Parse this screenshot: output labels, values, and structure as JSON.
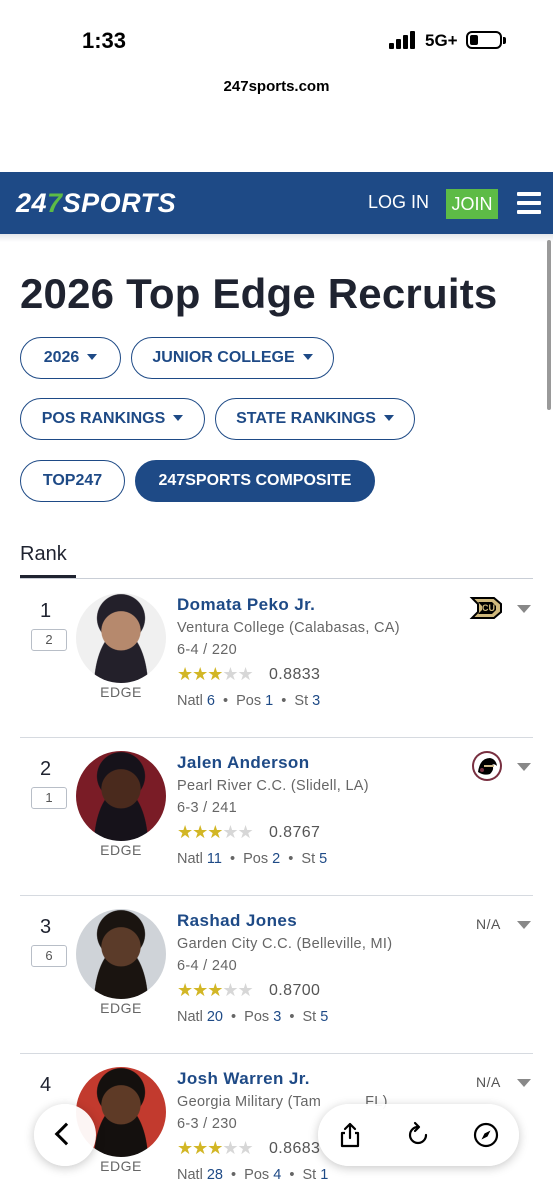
{
  "status_bar": {
    "time": "1:33",
    "network": "5G+"
  },
  "browser": {
    "url": "247sports.com"
  },
  "header": {
    "logo_prefix": "24",
    "logo_seven": "7",
    "logo_suffix": "SPORTS",
    "login_label": "LOG IN",
    "join_label": "JOIN"
  },
  "page": {
    "title": "2026 Top Edge Recruits"
  },
  "filters": {
    "year": "2026",
    "level": "JUNIOR COLLEGE",
    "pos_rankings": "POS RANKINGS",
    "state_rankings": "STATE RANKINGS",
    "top247": "TOP247",
    "composite": "247SPORTS COMPOSITE"
  },
  "tabs": {
    "rank": "Rank"
  },
  "recruits": [
    {
      "rank": "1",
      "prev_rank": "2",
      "name": "Domata Peko Jr.",
      "school": "Ventura College (Calabasas, CA)",
      "measurements": "6-4 / 220",
      "stars": 3,
      "rating": "0.8833",
      "natl_label": "Natl",
      "natl": "6",
      "pos_label": "Pos",
      "pos": "1",
      "st_label": "St",
      "st": "3",
      "position": "EDGE",
      "commit": "colorado-logo"
    },
    {
      "rank": "2",
      "prev_rank": "1",
      "name": "Jalen Anderson",
      "school": "Pearl River C.C. (Slidell, LA)",
      "measurements": "6-3 / 241",
      "stars": 3,
      "rating": "0.8767",
      "natl_label": "Natl",
      "natl": "11",
      "pos_label": "Pos",
      "pos": "2",
      "st_label": "St",
      "st": "5",
      "position": "EDGE",
      "commit": "florida-state-logo"
    },
    {
      "rank": "3",
      "prev_rank": "6",
      "name": "Rashad Jones",
      "school": "Garden City C.C. (Belleville, MI)",
      "measurements": "6-4 / 240",
      "stars": 3,
      "rating": "0.8700",
      "natl_label": "Natl",
      "natl": "20",
      "pos_label": "Pos",
      "pos": "3",
      "st_label": "St",
      "st": "5",
      "position": "EDGE",
      "commit_text": "N/A"
    },
    {
      "rank": "4",
      "prev_rank": "",
      "name": "Josh Warren Jr.",
      "school": "Georgia Military (Tam",
      "school_tail": "FL)",
      "measurements": "6-3 / 230",
      "stars": 3,
      "rating": "0.8683",
      "natl_label": "Natl",
      "natl": "28",
      "pos_label": "Pos",
      "pos": "4",
      "st_label": "St",
      "st": "1",
      "position": "EDGE",
      "commit_text": "N/A"
    }
  ],
  "colors": {
    "brand_blue": "#1e4a86",
    "brand_green": "#5dbb46",
    "star_gold": "#d2b625"
  }
}
